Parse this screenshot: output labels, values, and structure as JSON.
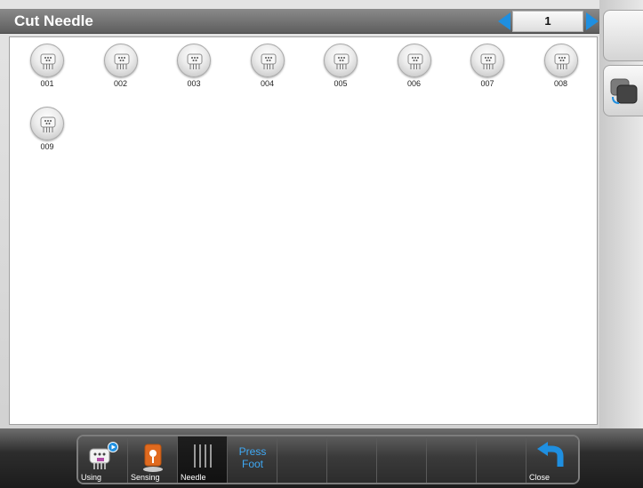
{
  "window": {
    "title": "Cut Needle"
  },
  "pager": {
    "page": "1",
    "prev_icon": "left-arrow-icon",
    "next_icon": "right-arrow-icon",
    "accent": "#1f8fe0"
  },
  "items": [
    {
      "label": "001"
    },
    {
      "label": "002"
    },
    {
      "label": "003"
    },
    {
      "label": "004"
    },
    {
      "label": "005"
    },
    {
      "label": "006"
    },
    {
      "label": "007"
    },
    {
      "label": "008"
    },
    {
      "label": "009"
    }
  ],
  "item_icon": "cut-needle-icon",
  "side": {
    "button2_icon": "layers-icon"
  },
  "toolbar": {
    "using_label": "Using",
    "sensing_label": "Sensing",
    "needle_label": "Needle",
    "press_foot_line1": "Press",
    "press_foot_line2": "Foot",
    "close_label": "Close"
  }
}
